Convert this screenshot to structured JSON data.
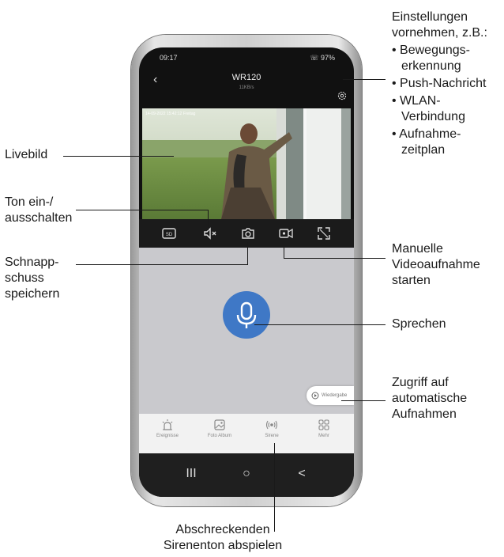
{
  "callouts": {
    "settings": {
      "heading": [
        "Einstellungen",
        "vornehmen, z.B.:"
      ],
      "items": [
        [
          "Bewegungs-",
          "erkennung"
        ],
        [
          "Push-Nachricht"
        ],
        [
          "WLAN-",
          "Verbindung"
        ],
        [
          "Aufnahme-",
          "zeitplan"
        ]
      ]
    },
    "livebild": "Livebild",
    "sound": [
      "Ton ein-/",
      "ausschalten"
    ],
    "snapshot": [
      "Schnapp-",
      "schuss",
      "speichern"
    ],
    "record": [
      "Manuelle",
      "Videoaufnahme",
      "starten"
    ],
    "speak": "Sprechen",
    "recordings": [
      "Zugriff auf",
      "automatische",
      "Aufnahmen"
    ],
    "siren": [
      "Abschreckenden",
      "Sirenenton abspielen"
    ]
  },
  "phone": {
    "status": {
      "time": "09:17",
      "sys": "☏ 97%"
    },
    "camera_name": "WR120",
    "bitrate": "11KB/s",
    "timestamp": "14-09-2022 15:42:12 Freitag",
    "tabs": [
      {
        "label": "Ereignisse",
        "icon": "events-icon"
      },
      {
        "label": "Foto Album",
        "icon": "photo-album-icon"
      },
      {
        "label": "Sirene",
        "icon": "siren-icon"
      },
      {
        "label": "Mehr",
        "icon": "more-icon"
      }
    ],
    "playback_label": "Wiedergabe",
    "nav": {
      "recents": "III",
      "home": "○",
      "back": "<"
    }
  },
  "colors": {
    "mic_button": "#3f78c6",
    "panel": "#c9c9cd"
  }
}
